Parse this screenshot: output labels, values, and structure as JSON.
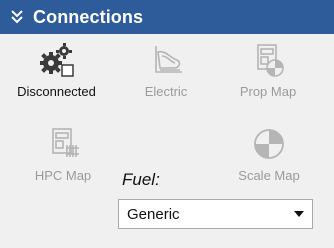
{
  "panel": {
    "title": "Connections",
    "collapse_icon": "double-chevron-down-icon"
  },
  "tools": [
    {
      "label": "Disconnected",
      "icon": "gears-disconnected-icon",
      "enabled": true
    },
    {
      "label": "Electric",
      "icon": "electric-icon",
      "enabled": false
    },
    {
      "label": "Prop Map",
      "icon": "prop-map-icon",
      "enabled": false
    },
    {
      "label": "HPC Map",
      "icon": "hpc-map-icon",
      "enabled": false
    },
    {
      "label": "Scale Map",
      "icon": "scale-map-icon",
      "enabled": false
    }
  ],
  "fuel": {
    "label": "Fuel:",
    "selected": "Generic"
  },
  "colors": {
    "header_bg": "#2e5c9a",
    "header_text": "#ffffff",
    "panel_bg": "#f0f0f0",
    "disabled_text": "#9a9a9a"
  }
}
